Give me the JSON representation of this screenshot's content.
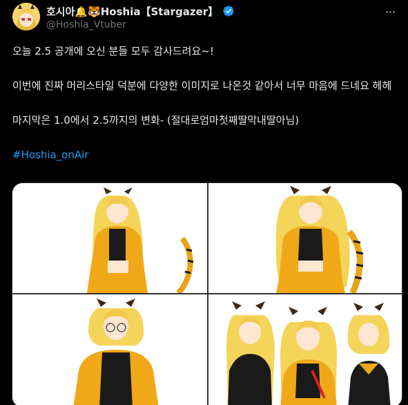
{
  "tweet": {
    "author": {
      "display_name": "호시아🔔🐯Hoshia【Stargazer】",
      "handle": "@Hoshia_Vtuber",
      "verified": true
    },
    "text": {
      "line1": "오늘 2.5 공개에 오신 분들 모두 감사드려요~!",
      "line2": "이번에 진짜 머리스타일 덕분에 다양한 이미지로 나온것 같아서 너무 마음에 드네요 헤헤",
      "line3": "마지막은 1.0에서 2.5까지의 변화- (절대로엄마첫째딸막내딸아님)",
      "hashtag": "#Hoshia_onAir"
    },
    "media": [
      {
        "label": "image-1"
      },
      {
        "label": "image-2"
      },
      {
        "label": "image-3"
      },
      {
        "label": "image-4"
      }
    ],
    "colors": {
      "background": "#000000",
      "text": "#e7e9ea",
      "secondary": "#71767b",
      "link": "#1d9bf0"
    },
    "icons": [
      "avatar",
      "verified-badge-icon",
      "more-options-icon"
    ]
  }
}
